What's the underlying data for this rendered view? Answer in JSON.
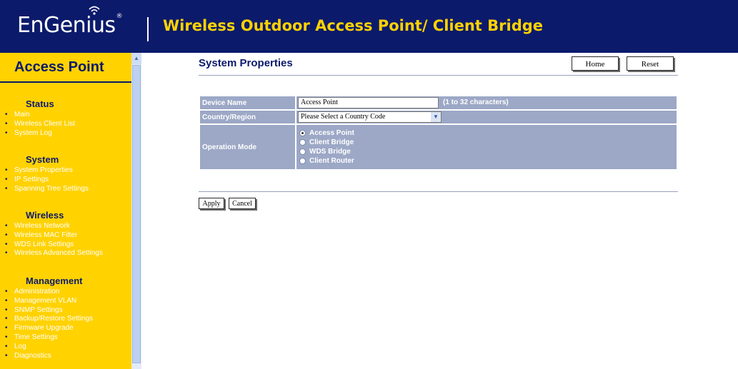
{
  "header": {
    "logo_text": "EnGenius",
    "logo_mark": "®",
    "title": "Wireless Outdoor Access Point/ Client Bridge"
  },
  "sidebar": {
    "title": "Access Point",
    "sections": [
      {
        "heading": "Status",
        "items": [
          "Main",
          "Wireless Client List",
          "System Log"
        ]
      },
      {
        "heading": "System",
        "items": [
          "System Properties",
          "IP Settings",
          "Spanning Tree Settings"
        ]
      },
      {
        "heading": "Wireless",
        "items": [
          "Wireless Network",
          "Wireless MAC Filter",
          "WDS Link Settings",
          "Wireless Advanced Settings"
        ]
      },
      {
        "heading": "Management",
        "items": [
          "Administration",
          "Management VLAN",
          "SNMP Settings",
          "Backup/Restore Settings",
          "Firmware Upgrade",
          "Time Settings",
          "Log",
          "Diagnostics"
        ]
      }
    ]
  },
  "main": {
    "page_title": "System Properties",
    "home_button": "Home",
    "reset_button": "Reset",
    "form": {
      "device_name_label": "Device Name",
      "device_name_value": "Access Point",
      "device_name_hint": "(1 to 32 characters)",
      "country_label": "Country/Region",
      "country_value": "Please Select a Country Code",
      "operation_mode_label": "Operation Mode",
      "operation_modes": [
        "Access Point",
        "Client Bridge",
        "WDS Bridge",
        "Client Router"
      ],
      "selected_mode": "Access Point"
    },
    "apply_button": "Apply",
    "cancel_button": "Cancel"
  },
  "colors": {
    "header_bg": "#0b1a6b",
    "header_title": "#ffd200",
    "sidebar_bg": "#ffd200",
    "table_cell": "#9ca8c6"
  }
}
